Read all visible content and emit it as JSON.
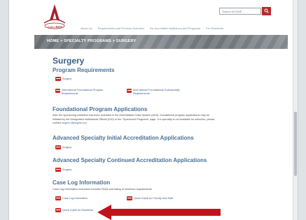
{
  "header": {
    "logo_text": "CALIBRE",
    "search_placeholder": "Search ACGME...",
    "nav": [
      "About Us",
      "Requirements and Process Overview",
      "For Accredited Institutions and Programs",
      "For Residents"
    ]
  },
  "banner": {
    "breadcrumb": "HOME > SPECIALTY PROGRAMS > SURGERY"
  },
  "main": {
    "title": "Surgery",
    "sections": [
      {
        "heading": "Program Requirements",
        "links": [
          "Surgery",
          "International Foundational Program Requirements",
          "International Foundational Subspecialty Requirements"
        ]
      },
      {
        "heading": "Foundational Program Applications",
        "text": "After the sponsoring institution has been activated in the Accreditation Data System (ADS), foundational program applications may be initiated by the Designated Institutional Official (DIO) in the \"Sponsored Programs\" page. If a specialty is not available for selection, please contact",
        "link": "acgme-i@acgme.org"
      },
      {
        "heading": "Advanced Specialty Initial Accreditation Applications",
        "links": [
          "Surgery"
        ]
      },
      {
        "heading": "Advanced Specialty Continued Accreditation Applications",
        "links": [
          "Surgery"
        ]
      },
      {
        "heading": "Case Log Information",
        "text": "Case Log Information document includes FAQs and listing of minimum requirements.",
        "links": [
          "Case Log Information",
          "Quick Guide for Faculty and Staff",
          "Quick Guide for Residents"
        ]
      }
    ]
  },
  "colors": {
    "accent_red": "#cc2a24",
    "heading_blue": "#3a5f86",
    "arrow_red": "#c0141c"
  }
}
